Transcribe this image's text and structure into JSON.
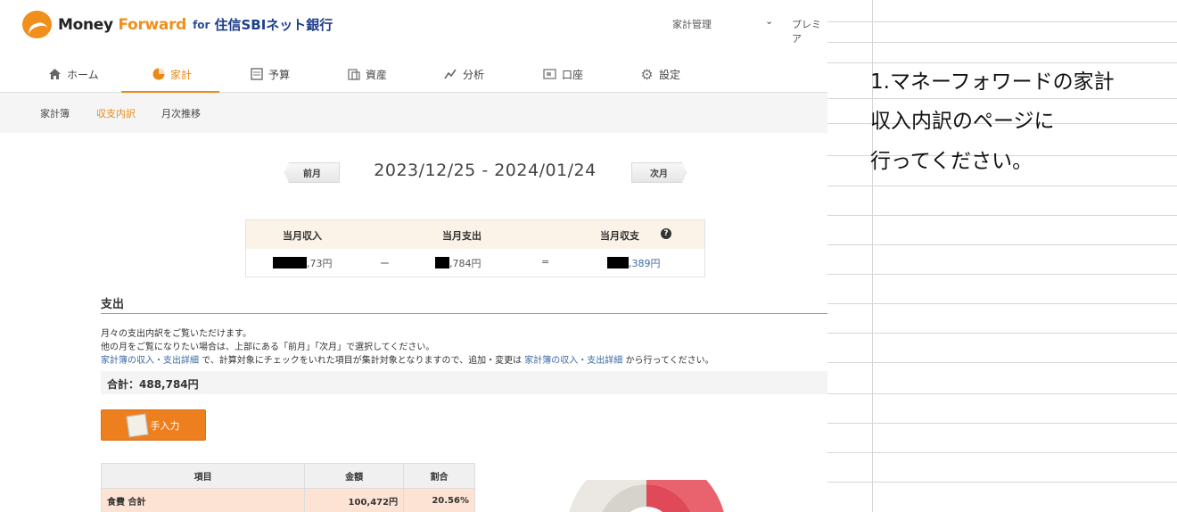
{
  "header": {
    "logo_money": "Money ",
    "logo_forward": "Forward",
    "logo_for": "for",
    "logo_bank": "住信SBIネット銀行",
    "menu_kakei": "家計管理",
    "menu_premium": "プレミア"
  },
  "nav": [
    {
      "label": "ホーム",
      "icon": "home-icon"
    },
    {
      "label": "家計",
      "icon": "pie-chart-icon"
    },
    {
      "label": "予算",
      "icon": "budget-icon"
    },
    {
      "label": "資産",
      "icon": "asset-icon"
    },
    {
      "label": "分析",
      "icon": "analysis-icon"
    },
    {
      "label": "口座",
      "icon": "account-icon"
    },
    {
      "label": "設定",
      "icon": "gear-icon"
    }
  ],
  "subnav": [
    "家計簿",
    "収支内訳",
    "月次推移"
  ],
  "period": {
    "prev": "前月",
    "next": "次月",
    "range": "2023/12/25 - 2024/01/24"
  },
  "summary": {
    "income_label": "当月収入",
    "expense_label": "当月支出",
    "balance_label": "当月収支",
    "help": "?",
    "income_value": ",73円",
    "minus": "ー",
    "expense_value": ",784円",
    "equals": "=",
    "balance_value": ",389円"
  },
  "section": {
    "title": "支出",
    "line1": "月々の支出内訳をご覧いただけます。",
    "line2": "他の月をご覧になりたい場合は、上部にある「前月」「次月」で選択してください。",
    "line3_link1": "家計簿の収入・支出詳細",
    "line3_mid": " で、計算対象にチェックをいれた項目が集計対象となりますので、追加・変更は ",
    "line3_link2": "家計簿の収入・支出詳細",
    "line3_end": " から行ってください。",
    "total": "合計：488,784円",
    "manual_button": "手入力"
  },
  "table": {
    "headers": [
      "項目",
      "金額",
      "割合"
    ],
    "rows": [
      {
        "item": "食費 合計",
        "amount": "100,472円",
        "ratio": "20.56%"
      }
    ]
  },
  "note": {
    "line1": "1.マネーフォワードの家計",
    "line2": "収入内訳のページに",
    "line3": "行ってください。"
  },
  "colors": {
    "accent": "#e8891a",
    "link": "#3b6aa3",
    "button": "#ee7f1f"
  }
}
